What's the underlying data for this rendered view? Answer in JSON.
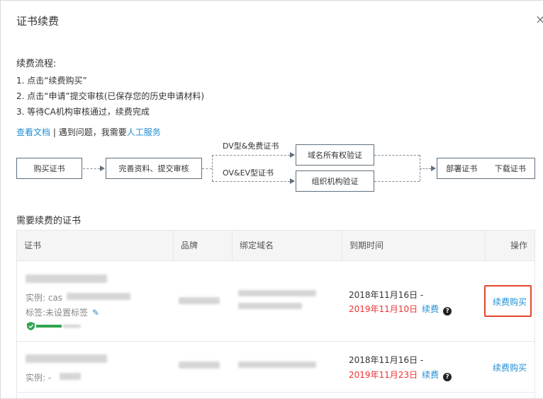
{
  "dialog": {
    "title": "证书续费",
    "close_symbol": "×"
  },
  "process": {
    "heading": "续费流程:",
    "steps": [
      "1. 点击“续费购买”",
      "2. 点击“申请”提交审核(已保存您的历史申请材料)",
      "3. 等待CA机构审核通过，续费完成"
    ]
  },
  "help": {
    "doc_link": "查看文档",
    "separator": " | ",
    "question": "遇到问题，我需要",
    "service_link": "人工服务"
  },
  "flow": {
    "buy": "购买证书",
    "submit": "完善资料、提交审核",
    "dv_label": "DV型&免费证书",
    "ov_label": "OV&EV型证书",
    "domain_verify": "域名所有权验证",
    "org_verify": "组织机构验证",
    "deploy": "部署证书",
    "download": "下载证书"
  },
  "table": {
    "heading": "需要续费的证书",
    "columns": [
      "证书",
      "品牌",
      "绑定域名",
      "到期时间",
      "操作"
    ],
    "rows": [
      {
        "instance_prefix": "实例: cas",
        "tag_label": "标签:未设置标签",
        "start_date": "2018年11月16日 -",
        "end_date": "2019年11月10日",
        "renew_label": "续费",
        "action": "续费购买"
      },
      {
        "instance_prefix": "实例: -",
        "start_date": "2018年11月16日 -",
        "end_date": "2019年11月23日",
        "renew_label": "续费",
        "action": "续费购买"
      }
    ]
  },
  "colors": {
    "link": "#1e8fd6",
    "expiry": "#e33333",
    "highlight": "#e2462c"
  },
  "icons": [
    "close-icon",
    "edit-icon",
    "shield-icon",
    "help-icon"
  ]
}
